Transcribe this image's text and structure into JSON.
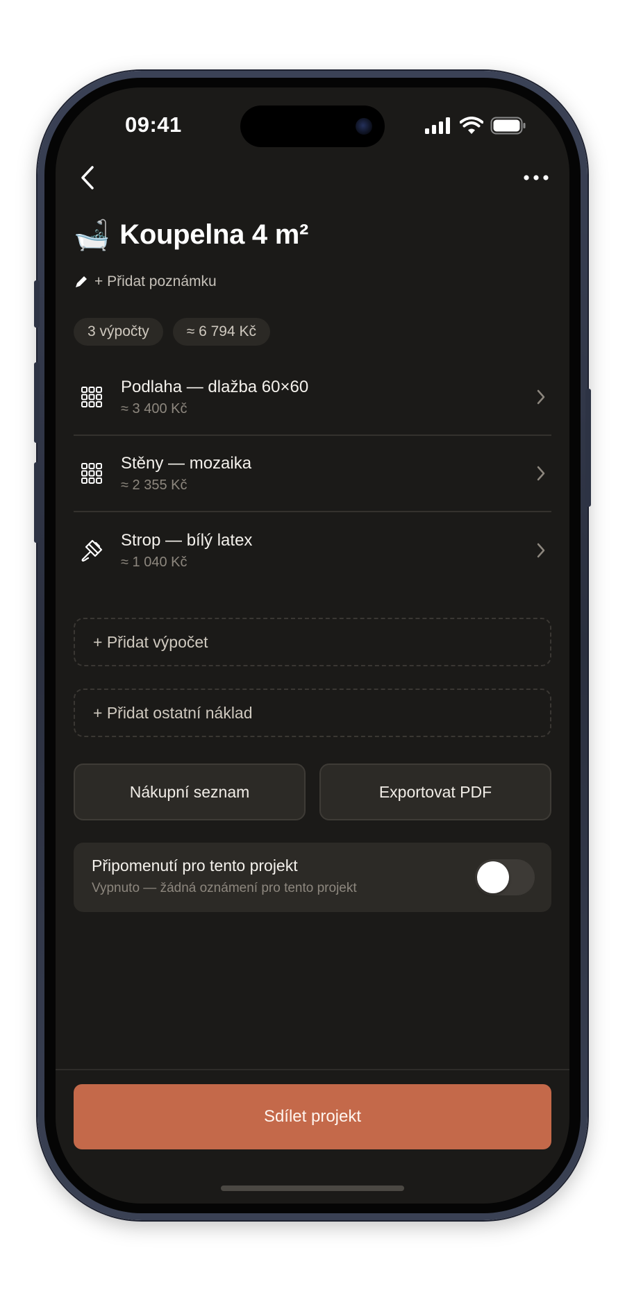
{
  "status_bar": {
    "time": "09:41"
  },
  "project": {
    "emoji": "🛁",
    "title": "Koupelna 4 m²",
    "add_note_label": "+ Přidat poznámku"
  },
  "chips": {
    "calculations": "3 výpočty",
    "total": "≈ 6 794 Kč"
  },
  "items": [
    {
      "title": "Podlaha — dlažba 60×60",
      "price": "≈ 3 400 Kč",
      "icon": "tile-grid-icon"
    },
    {
      "title": "Stěny — mozaika",
      "price": "≈ 2 355 Kč",
      "icon": "tile-grid-icon"
    },
    {
      "title": "Strop — bílý latex",
      "price": "≈ 1 040 Kč",
      "icon": "paint-brush-icon"
    }
  ],
  "actions": {
    "add_calculation": "+ Přidat výpočet",
    "add_other_cost": "+ Přidat ostatní náklad",
    "shopping_list": "Nákupní seznam",
    "export_pdf": "Exportovat PDF",
    "share": "Sdílet projekt"
  },
  "reminder": {
    "title": "Připomenutí pro tento projekt",
    "subtitle": "Vypnuto — žádná oznámení pro tento projekt",
    "enabled": false
  },
  "colors": {
    "background": "#1b1a18",
    "accent": "#c4694a",
    "card": "#2c2a26",
    "muted_text": "#8d877e"
  }
}
